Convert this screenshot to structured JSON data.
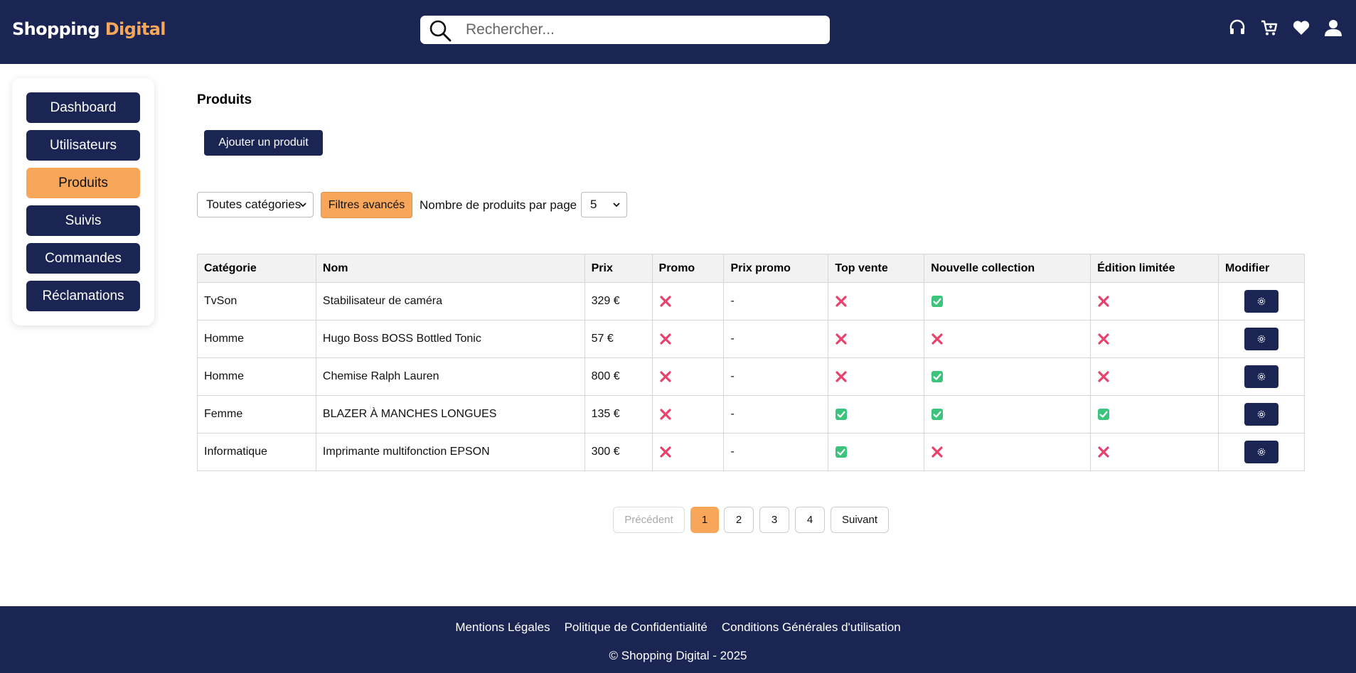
{
  "brand": {
    "part1": "Shopping",
    "part2": "Digital"
  },
  "search": {
    "placeholder": "Rechercher..."
  },
  "header_icons": [
    "headset-icon",
    "cart-icon",
    "heart-icon",
    "user-icon"
  ],
  "sidebar": {
    "items": [
      {
        "label": "Dashboard",
        "active": false
      },
      {
        "label": "Utilisateurs",
        "active": false
      },
      {
        "label": "Produits",
        "active": true
      },
      {
        "label": "Suivis",
        "active": false
      },
      {
        "label": "Commandes",
        "active": false
      },
      {
        "label": "Réclamations",
        "active": false
      }
    ]
  },
  "main": {
    "title": "Produits",
    "add_label": "Ajouter un produit",
    "category_select": "Toutes catégories",
    "filters_label": "Filtres avancés",
    "per_page_label": "Nombre de produits par page",
    "per_page_value": "5"
  },
  "table": {
    "headers": [
      "Catégorie",
      "Nom",
      "Prix",
      "Promo",
      "Prix promo",
      "Top vente",
      "Nouvelle collection",
      "Édition limitée",
      "Modifier"
    ],
    "rows": [
      {
        "categorie": "TvSon",
        "nom": "Stabilisateur de caméra",
        "prix": "329 €",
        "promo": false,
        "prix_promo": "-",
        "top_vente": false,
        "nouvelle_collection": true,
        "edition_limitee": false
      },
      {
        "categorie": "Homme",
        "nom": "Hugo Boss BOSS Bottled Tonic",
        "prix": "57 €",
        "promo": false,
        "prix_promo": "-",
        "top_vente": false,
        "nouvelle_collection": false,
        "edition_limitee": false
      },
      {
        "categorie": "Homme",
        "nom": "Chemise Ralph Lauren",
        "prix": "800 €",
        "promo": false,
        "prix_promo": "-",
        "top_vente": false,
        "nouvelle_collection": true,
        "edition_limitee": false
      },
      {
        "categorie": "Femme",
        "nom": "BLAZER À MANCHES LONGUES",
        "prix": "135 €",
        "promo": false,
        "prix_promo": "-",
        "top_vente": true,
        "nouvelle_collection": true,
        "edition_limitee": true
      },
      {
        "categorie": "Informatique",
        "nom": "Imprimante multifonction EPSON",
        "prix": "300 €",
        "promo": false,
        "prix_promo": "-",
        "top_vente": true,
        "nouvelle_collection": false,
        "edition_limitee": false
      }
    ]
  },
  "pagination": {
    "prev": "Précédent",
    "pages": [
      "1",
      "2",
      "3",
      "4"
    ],
    "current": "1",
    "next": "Suivant"
  },
  "footer": {
    "links": [
      "Mentions Légales",
      "Politique de Confidentialité",
      "Conditions Générales d'utilisation"
    ],
    "copyright": "© Shopping Digital - 2025"
  },
  "colors": {
    "navy": "#1b2554",
    "orange": "#f7a65a",
    "check_green": "#3cc47c",
    "cross_red": "#e8416c"
  }
}
